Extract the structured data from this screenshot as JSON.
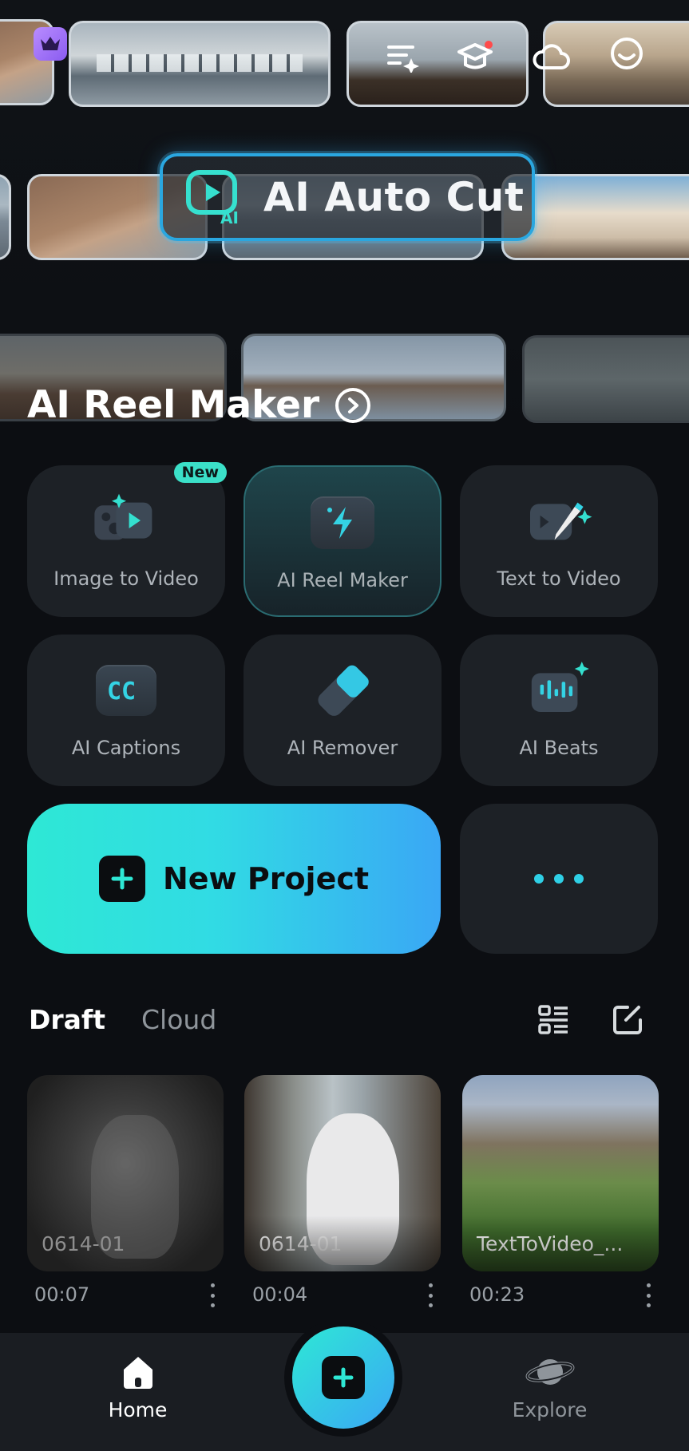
{
  "hero": {
    "banner_label": "AI Auto Cut",
    "title": "AI Reel Maker"
  },
  "features": [
    {
      "label": "Image to Video",
      "badge": "New",
      "icon": "image-to-video-icon"
    },
    {
      "label": "AI Reel Maker",
      "icon": "lightning-icon"
    },
    {
      "label": "Text to Video",
      "icon": "pencil-sparkle-icon"
    },
    {
      "label": "AI Captions",
      "icon": "cc-icon"
    },
    {
      "label": "AI Remover",
      "icon": "eraser-icon"
    },
    {
      "label": "AI Beats",
      "icon": "beats-icon"
    }
  ],
  "actions": {
    "new_project": "New Project"
  },
  "drafts_tabs": {
    "draft": "Draft",
    "cloud": "Cloud"
  },
  "drafts": [
    {
      "name": "0614-01",
      "duration": "00:07"
    },
    {
      "name": "0614-01",
      "duration": "00:04"
    },
    {
      "name": "TextToVideo_...",
      "duration": "00:23"
    }
  ],
  "nav": {
    "home": "Home",
    "explore": "Explore"
  },
  "colors": {
    "accent_start": "#2ee8d5",
    "accent_end": "#3aa7f5",
    "background": "#0c0e12",
    "card": "#1d2126"
  }
}
